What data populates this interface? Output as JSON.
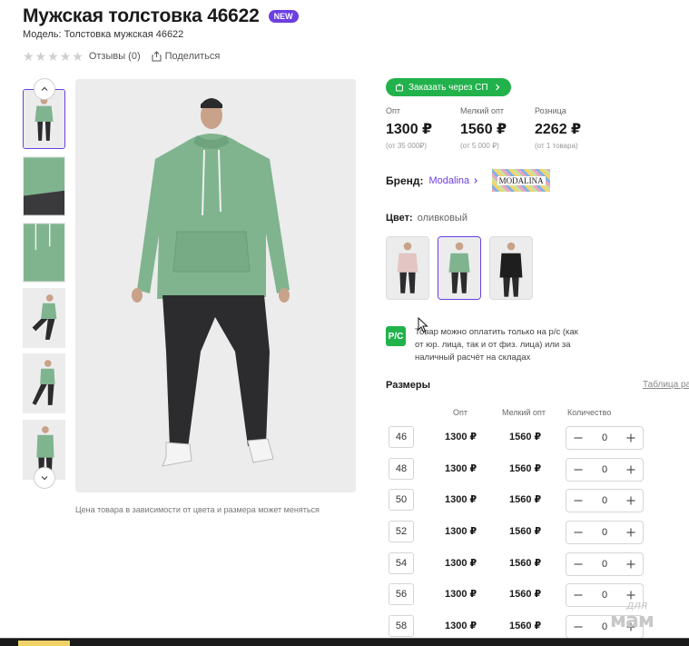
{
  "product": {
    "title": "Мужская толстовка 46622",
    "badge": "NEW",
    "model": "Модель: Толстовка мужская 46622",
    "reviews": "Отзывы (0)",
    "share": "Поделиться"
  },
  "rating": {
    "value": 0,
    "max": 5
  },
  "gallery": {
    "note": "Цена товара в зависимости от цвета и размера может меняться"
  },
  "order": {
    "label": "Заказать через СП"
  },
  "prices": [
    {
      "label": "Опт",
      "value": "1300 ₽",
      "min": "(от 35 000₽)"
    },
    {
      "label": "Мелкий опт",
      "value": "1560 ₽",
      "min": "(от 5 000 ₽)"
    },
    {
      "label": "Розница",
      "value": "2262 ₽",
      "min": "(от 1 товара)"
    }
  ],
  "brand": {
    "label": "Бренд:",
    "name": "Modalina",
    "logo_text": "MODALINA"
  },
  "color": {
    "label": "Цвет:",
    "value": "оливковый"
  },
  "payment": {
    "icon_text": "Р/С",
    "text": "Товар можно оплатить только на р/с (как от юр. лица, так и от физ. лица) или за наличный расчёт на складах"
  },
  "sizes": {
    "title": "Размеры",
    "table_link": "Таблица размеров",
    "headers": {
      "opt": "Опт",
      "small_opt": "Мелкий опт",
      "qty": "Количество"
    },
    "rows": [
      {
        "size": "46",
        "opt": "1300 ₽",
        "small_opt": "1560 ₽",
        "qty": "0"
      },
      {
        "size": "48",
        "opt": "1300 ₽",
        "small_opt": "1560 ₽",
        "qty": "0"
      },
      {
        "size": "50",
        "opt": "1300 ₽",
        "small_opt": "1560 ₽",
        "qty": "0"
      },
      {
        "size": "52",
        "opt": "1300 ₽",
        "small_opt": "1560 ₽",
        "qty": "0"
      },
      {
        "size": "54",
        "opt": "1300 ₽",
        "small_opt": "1560 ₽",
        "qty": "0"
      },
      {
        "size": "56",
        "opt": "1300 ₽",
        "small_opt": "1560 ₽",
        "qty": "0"
      },
      {
        "size": "58",
        "opt": "1300 ₽",
        "small_opt": "1560 ₽",
        "qty": "0"
      }
    ]
  },
  "watermark": {
    "line1": "для",
    "line2": "мам"
  },
  "colors": {
    "accent": "#6b3fe0",
    "green": "#22b24c",
    "hoodie": "#7fb48f",
    "photo_bg": "#ececec"
  }
}
